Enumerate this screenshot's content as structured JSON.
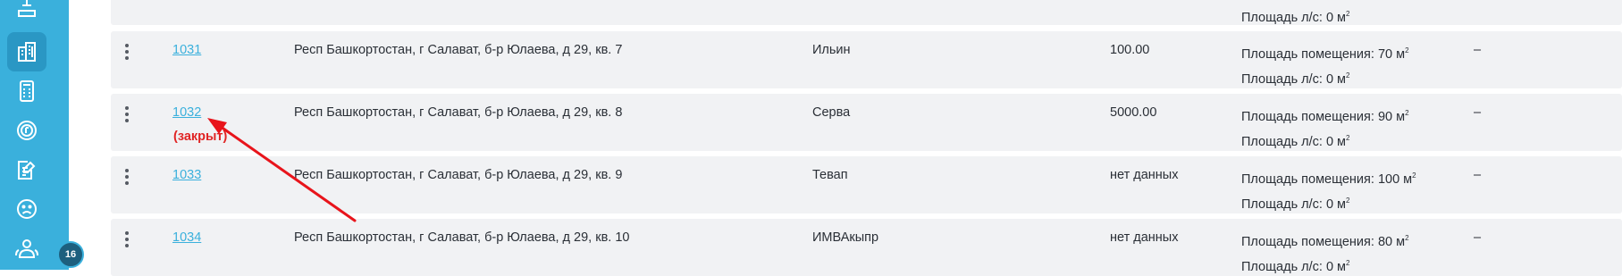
{
  "sidebar": {
    "icons": [
      "tray-icon",
      "buildings-icon",
      "calculator-icon",
      "coin-icon",
      "edit-document-icon",
      "sad-face-icon",
      "users-icon"
    ],
    "badge": "16"
  },
  "rows": [
    {
      "id": "",
      "closed": "",
      "address": "",
      "owner": "",
      "amount": "",
      "area_room": "",
      "area_ls": "Площадь л/с: 0 м",
      "note": ""
    },
    {
      "id": "1031",
      "closed": "",
      "address": "Респ Башкортостан, г Салават, б-р Юлаева, д 29, кв. 7",
      "owner": "Ильин",
      "amount": "100.00",
      "area_room": "Площадь помещения: 70 м",
      "area_ls": "Площадь л/с: 0 м",
      "note": "–"
    },
    {
      "id": "1032",
      "closed": "(закрыт)",
      "address": "Респ Башкортостан, г Салават, б-р Юлаева, д 29, кв. 8",
      "owner": "Серва",
      "amount": "5000.00",
      "area_room": "Площадь помещения: 90 м",
      "area_ls": "Площадь л/с: 0 м",
      "note": "–"
    },
    {
      "id": "1033",
      "closed": "",
      "address": "Респ Башкортостан, г Салават, б-р Юлаева, д 29, кв. 9",
      "owner": "Тевап",
      "amount": "нет данных",
      "area_room": "Площадь помещения: 100 м",
      "area_ls": "Площадь л/с: 0 м",
      "note": "–"
    },
    {
      "id": "1034",
      "closed": "",
      "address": "Респ Башкортостан, г Салават, б-р Юлаева, д 29, кв. 10",
      "owner": "ИМВАкыпр",
      "amount": "нет данных",
      "area_room": "Площадь помещения: 80 м",
      "area_ls": "Площадь л/с: 0 м",
      "note": "–"
    }
  ],
  "units": {
    "squared": "2"
  },
  "colors": {
    "sidebar": "#3ab0dc",
    "link": "#3ab0dc",
    "closed": "#e02424",
    "row_bg": "#f1f2f4",
    "annotation_arrow": "#e8141b"
  }
}
